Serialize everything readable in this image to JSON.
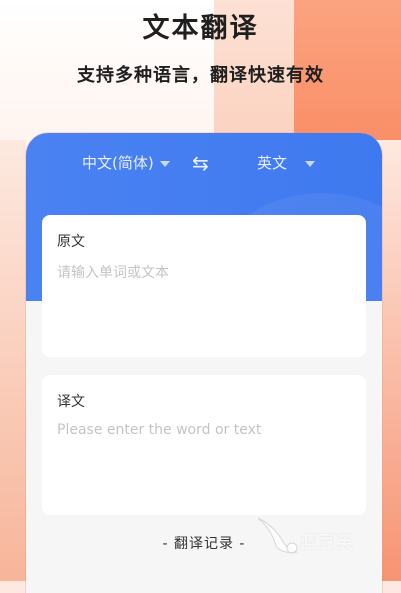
{
  "header": {
    "title": "文本翻译",
    "subtitle": "支持多种语言，翻译快速有效"
  },
  "language_bar": {
    "source_language": "中文(简体)",
    "target_language": "英文",
    "swap_icon": "swap-arrows-icon"
  },
  "source_card": {
    "title": "原文",
    "placeholder": "请输入单词或文本"
  },
  "result_card": {
    "title": "译文",
    "placeholder": "Please enter the word or text"
  },
  "history": {
    "label": "- 翻译记录 -"
  },
  "watermark": {
    "text": "蓝豆英",
    "icon": "bird-logo-icon"
  },
  "colors": {
    "accent_blue": "#4a82f2",
    "accent_orange": "#f98f68"
  }
}
